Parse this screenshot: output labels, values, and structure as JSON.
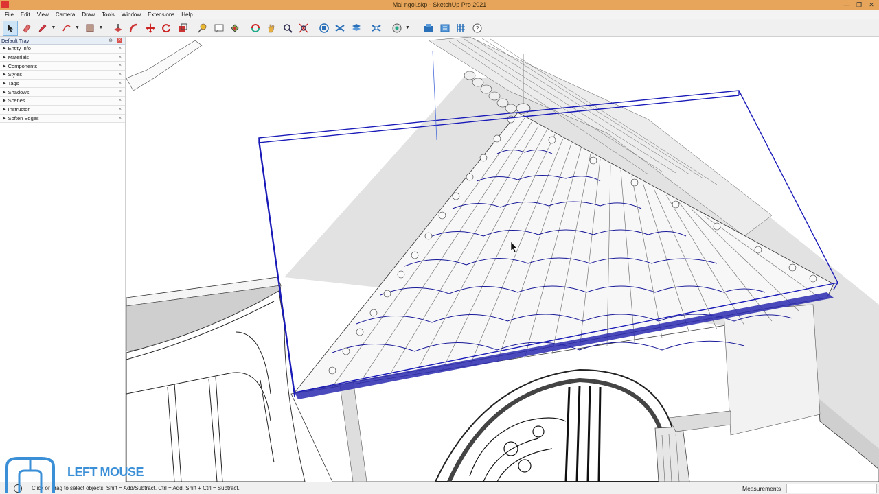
{
  "window": {
    "title": "Mai ngoi.skp - SketchUp Pro 2021"
  },
  "menu": [
    "File",
    "Edit",
    "View",
    "Camera",
    "Draw",
    "Tools",
    "Window",
    "Extensions",
    "Help"
  ],
  "toolbar_icons": [
    "select-icon",
    "eraser-icon",
    "pencil-icon",
    "arc-icon",
    "rectangle-icon",
    "push-pull-icon",
    "follow-me-icon",
    "move-icon",
    "rotate-icon",
    "scale-icon",
    "tape-measure-icon",
    "text-icon",
    "paint-bucket-icon",
    "orbit-icon",
    "pan-icon",
    "zoom-icon",
    "zoom-extents-icon",
    "3d-warehouse-icon",
    "extension-warehouse-icon",
    "layout-icon",
    "extension-manager-icon",
    "geo-location-icon",
    "components-icon",
    "tags-icon",
    "outliner-icon",
    "help-icon"
  ],
  "tray": {
    "title": "Default Tray",
    "panels": [
      "Entity Info",
      "Materials",
      "Components",
      "Styles",
      "Tags",
      "Shadows",
      "Scenes",
      "Instructor",
      "Soften Edges"
    ]
  },
  "status": {
    "hint": "Click or drag to select objects. Shift = Add/Subtract. Ctrl = Add. Shift + Ctrl = Subtract.",
    "measurements_label": "Measurements",
    "measurements_value": ""
  },
  "watermark": {
    "text": "LEFT MOUSE"
  }
}
